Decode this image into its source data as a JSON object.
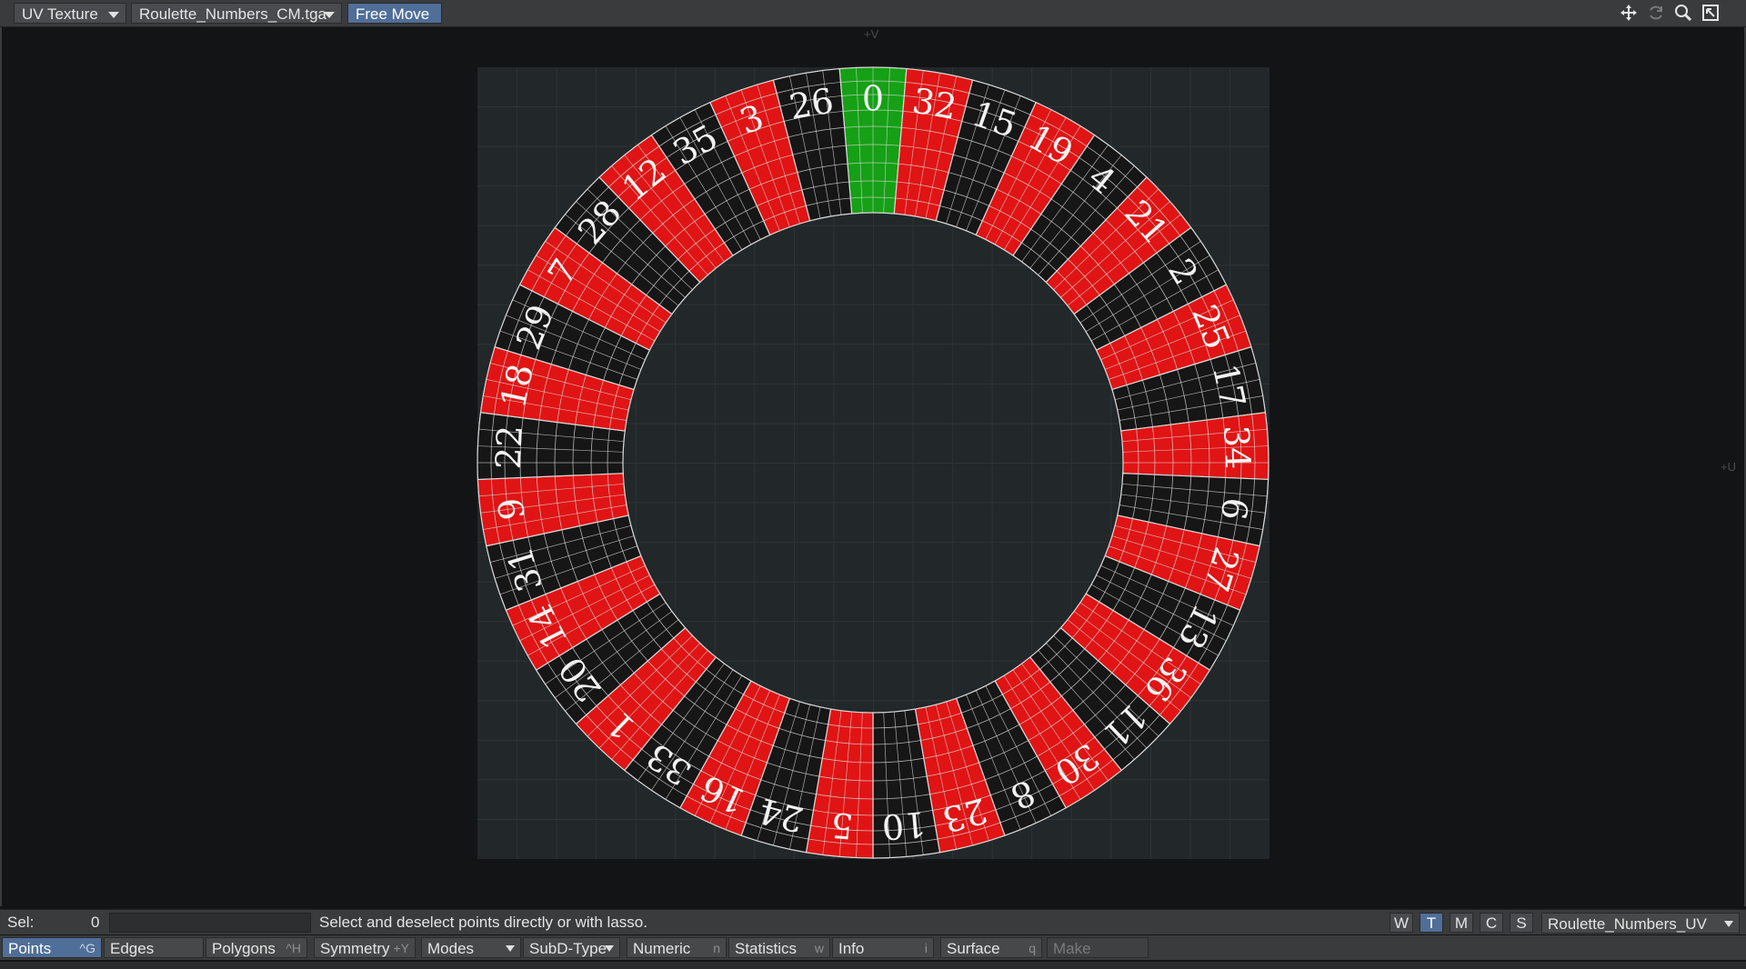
{
  "toolbar": {
    "view_type": "UV Texture",
    "image": "Roulette_Numbers_CM.tga",
    "mode": "Free Move"
  },
  "viewport": {
    "axis_top": "+V",
    "axis_right": "+U"
  },
  "wheel": {
    "numbers": [
      "0",
      "32",
      "15",
      "19",
      "4",
      "21",
      "2",
      "25",
      "17",
      "34",
      "6",
      "27",
      "13",
      "36",
      "11",
      "30",
      "8",
      "23",
      "10",
      "5",
      "24",
      "16",
      "33",
      "1",
      "20",
      "14",
      "31",
      "9",
      "22",
      "18",
      "29",
      "7",
      "28",
      "12",
      "35",
      "3",
      "26"
    ],
    "colors": {
      "red": "#e01414",
      "black": "#161616",
      "green": "#16a016",
      "background": "#22272a",
      "grid": "#2e3436",
      "wire": "#d8d8d8"
    }
  },
  "status": {
    "sel_label": "Sel:",
    "sel_value": "0",
    "message": "Select and deselect points directly or with lasso.",
    "view_buttons": [
      "W",
      "T",
      "M",
      "C",
      "S"
    ],
    "uv_map": "Roulette_Numbers_UV"
  },
  "bottom": {
    "points": "Points",
    "points_key": "^G",
    "edges": "Edges",
    "polygons": "Polygons",
    "polygons_key": "^H",
    "symmetry": "Symmetry",
    "symmetry_key": "+Y",
    "modes": "Modes",
    "subd": "SubD-Type",
    "numeric": "Numeric",
    "numeric_key": "n",
    "statistics": "Statistics",
    "statistics_key": "w",
    "info": "Info",
    "info_key": "i",
    "surface": "Surface",
    "surface_key": "q",
    "make": "Make"
  }
}
